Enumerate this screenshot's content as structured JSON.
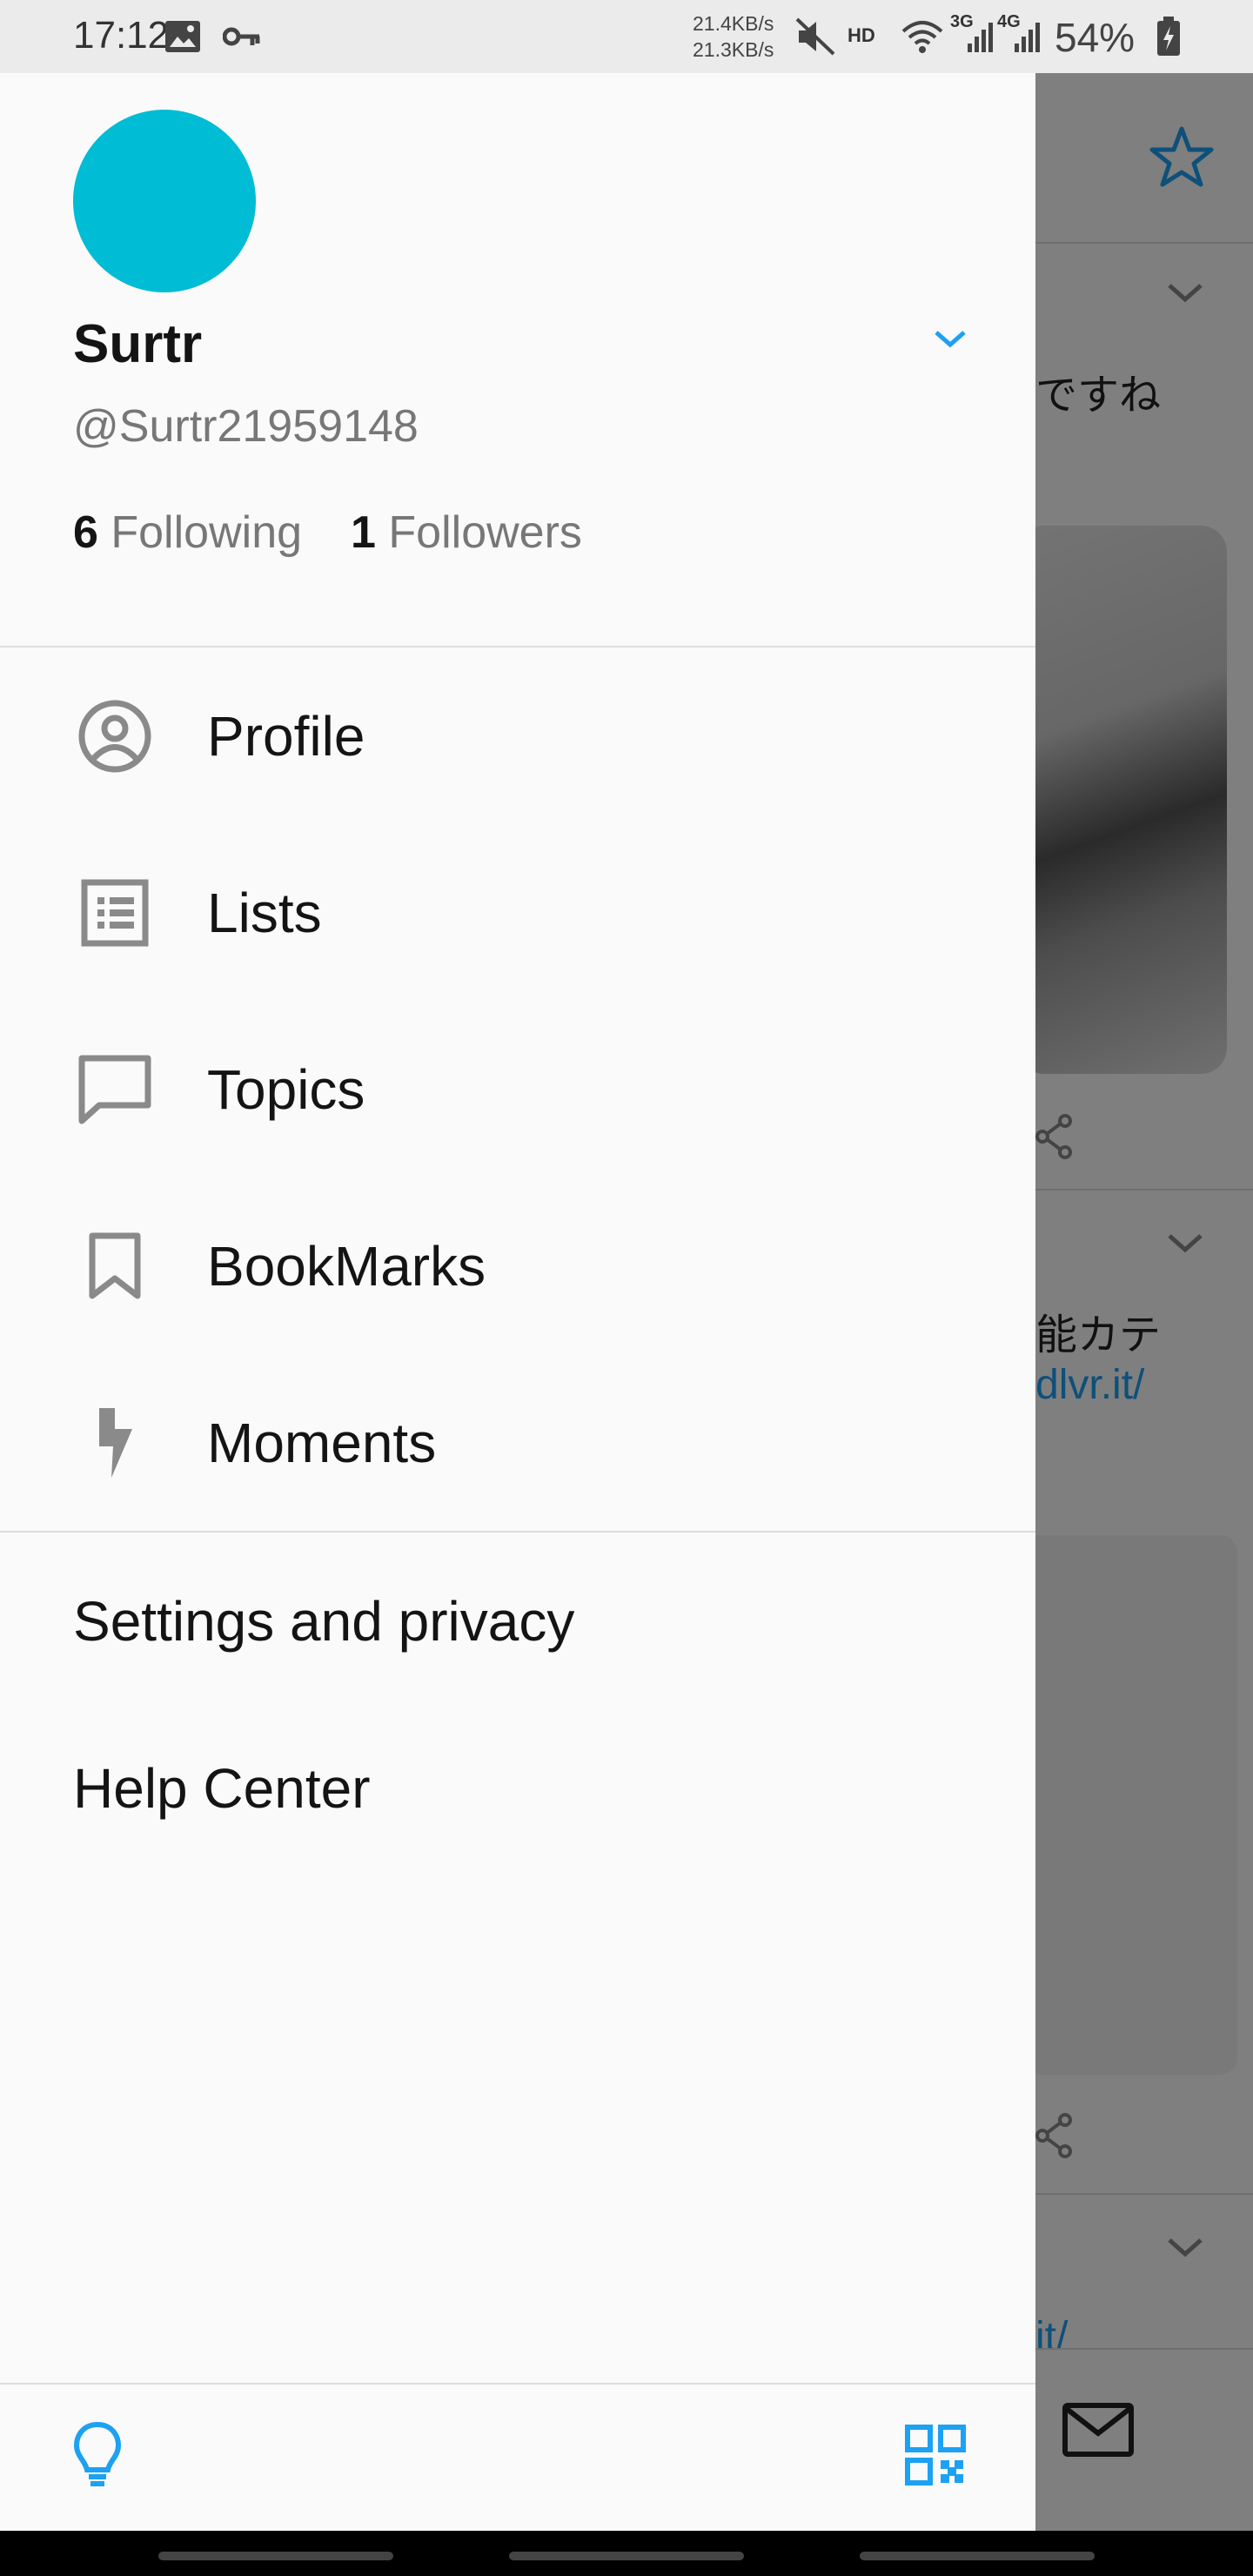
{
  "status_bar": {
    "time": "17:12",
    "speed_up": "21.4KB/s",
    "speed_down": "21.3KB/s",
    "hd": "HD",
    "net_3g": "3G",
    "net_4g": "4G",
    "battery": "54%",
    "icons": [
      "image-icon",
      "key-icon",
      "mute-icon",
      "wifi-icon",
      "signal-icon",
      "battery-icon"
    ]
  },
  "background": {
    "text1": "ですね",
    "text2": "能カテ",
    "link1": "dlvr.it/",
    "link2": "it/"
  },
  "drawer": {
    "name": "Surtr",
    "handle": "@Surtr21959148",
    "following_count": "6",
    "following_label": "Following",
    "followers_count": "1",
    "followers_label": "Followers",
    "menu": [
      {
        "label": "Profile",
        "icon": "profile-icon"
      },
      {
        "label": "Lists",
        "icon": "lists-icon"
      },
      {
        "label": "Topics",
        "icon": "topics-icon"
      },
      {
        "label": "BookMarks",
        "icon": "bookmark-icon"
      },
      {
        "label": "Moments",
        "icon": "moments-icon"
      }
    ],
    "settings": "Settings and privacy",
    "help": "Help Center",
    "avatar_color": "#00bcd4",
    "accent": "#1da1f2"
  }
}
